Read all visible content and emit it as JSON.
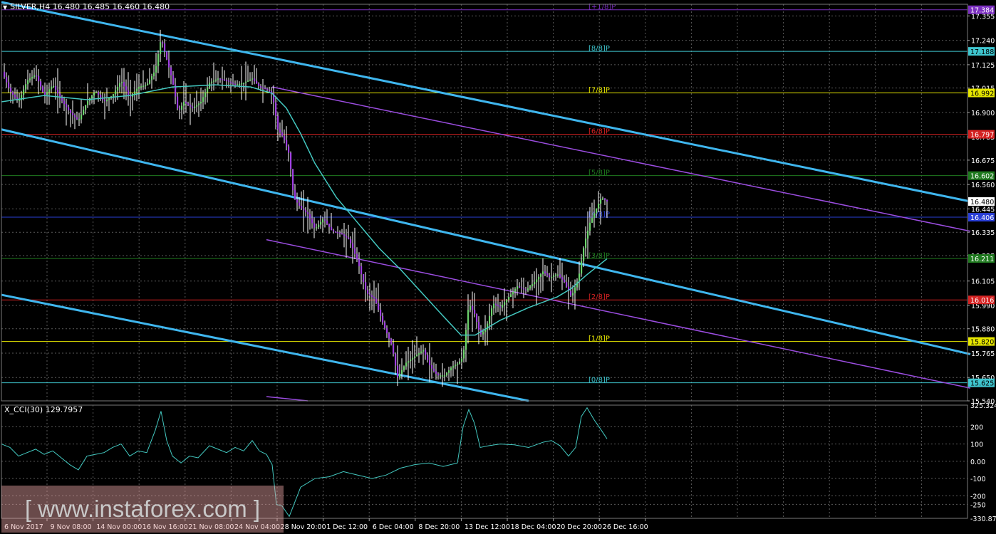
{
  "title": {
    "symbol": "SILVER,H4",
    "prices": "16.480 16.485 16.460 16.480"
  },
  "subtitle": "X_CCI(30) 129.7957",
  "watermark": "[ www.instaforex.com ]",
  "chart_data": [
    {
      "type": "candlestick",
      "ylim": [
        15.54,
        17.41
      ],
      "y_ticks": [
        "17.355",
        "17.240",
        "17.125",
        "17.015",
        "16.900",
        "16.785",
        "16.675",
        "16.560",
        "16.445",
        "16.335",
        "16.225",
        "16.105",
        "15.990",
        "15.880",
        "15.765",
        "15.650",
        "15.540"
      ],
      "x_ticks": [
        "6 Nov 2017",
        "9 Nov 08:00",
        "14 Nov 00:00",
        "16 Nov 16:00",
        "21 Nov 08:00",
        "24 Nov 04:00",
        "28 Nov 20:00",
        "1 Dec 12:00",
        "6 Dec 04:00",
        "8 Dec 20:00",
        "13 Dec 12:00",
        "18 Dec 04:00",
        "20 Dec 20:00",
        "26 Dec 16:00"
      ],
      "current_price": {
        "label": "16.480",
        "value": 16.48
      },
      "close_path": [
        [
          0,
          17.1
        ],
        [
          12,
          17.0
        ],
        [
          24,
          16.95
        ],
        [
          36,
          17.05
        ],
        [
          48,
          17.08
        ],
        [
          60,
          16.98
        ],
        [
          72,
          17.03
        ],
        [
          84,
          16.96
        ],
        [
          96,
          16.9
        ],
        [
          108,
          16.86
        ],
        [
          120,
          16.95
        ],
        [
          132,
          17.0
        ],
        [
          144,
          16.95
        ],
        [
          156,
          16.98
        ],
        [
          168,
          17.05
        ],
        [
          180,
          16.97
        ],
        [
          192,
          17.02
        ],
        [
          204,
          17.03
        ],
        [
          216,
          17.1
        ],
        [
          224,
          17.25
        ],
        [
          232,
          17.15
        ],
        [
          240,
          17.05
        ],
        [
          248,
          16.9
        ],
        [
          256,
          16.95
        ],
        [
          268,
          16.92
        ],
        [
          280,
          16.95
        ],
        [
          292,
          17.04
        ],
        [
          304,
          17.06
        ],
        [
          316,
          17.05
        ],
        [
          328,
          17.03
        ],
        [
          340,
          17.04
        ],
        [
          352,
          17.06
        ],
        [
          362,
          17.02
        ],
        [
          372,
          17.01
        ],
        [
          380,
          16.99
        ],
        [
          388,
          16.82
        ],
        [
          396,
          16.78
        ],
        [
          404,
          16.7
        ],
        [
          410,
          16.5
        ],
        [
          420,
          16.45
        ],
        [
          430,
          16.42
        ],
        [
          440,
          16.35
        ],
        [
          452,
          16.4
        ],
        [
          464,
          16.34
        ],
        [
          476,
          16.33
        ],
        [
          488,
          16.3
        ],
        [
          500,
          16.2
        ],
        [
          512,
          16.05
        ],
        [
          524,
          16.02
        ],
        [
          536,
          15.9
        ],
        [
          548,
          15.8
        ],
        [
          556,
          15.65
        ],
        [
          568,
          15.72
        ],
        [
          580,
          15.75
        ],
        [
          592,
          15.78
        ],
        [
          602,
          15.7
        ],
        [
          612,
          15.66
        ],
        [
          622,
          15.66
        ],
        [
          632,
          15.7
        ],
        [
          642,
          15.72
        ],
        [
          648,
          15.75
        ],
        [
          656,
          16.0
        ],
        [
          664,
          15.95
        ],
        [
          672,
          15.85
        ],
        [
          680,
          15.88
        ],
        [
          690,
          16.0
        ],
        [
          700,
          15.98
        ],
        [
          712,
          16.03
        ],
        [
          724,
          16.08
        ],
        [
          736,
          16.06
        ],
        [
          748,
          16.1
        ],
        [
          760,
          16.15
        ],
        [
          770,
          16.12
        ],
        [
          780,
          16.14
        ],
        [
          790,
          16.1
        ],
        [
          800,
          16.03
        ],
        [
          810,
          16.12
        ],
        [
          818,
          16.28
        ],
        [
          826,
          16.38
        ],
        [
          834,
          16.44
        ],
        [
          842,
          16.5
        ],
        [
          850,
          16.48
        ]
      ],
      "moving_average": [
        [
          0,
          16.95
        ],
        [
          60,
          16.98
        ],
        [
          120,
          16.96
        ],
        [
          180,
          16.98
        ],
        [
          240,
          17.02
        ],
        [
          300,
          17.03
        ],
        [
          350,
          17.02
        ],
        [
          380,
          16.99
        ],
        [
          400,
          16.92
        ],
        [
          420,
          16.8
        ],
        [
          440,
          16.66
        ],
        [
          470,
          16.5
        ],
        [
          500,
          16.38
        ],
        [
          530,
          16.26
        ],
        [
          560,
          16.16
        ],
        [
          590,
          16.05
        ],
        [
          620,
          15.94
        ],
        [
          645,
          15.85
        ],
        [
          665,
          15.85
        ],
        [
          700,
          15.92
        ],
        [
          740,
          15.98
        ],
        [
          780,
          16.03
        ],
        [
          800,
          16.07
        ],
        [
          820,
          16.13
        ],
        [
          850,
          16.21
        ]
      ],
      "murrey_levels": [
        {
          "label": "[+1/8]P",
          "value": 17.384,
          "price_label": "17.384",
          "color": "#7b2fbf"
        },
        {
          "label": "[8/8]P",
          "value": 17.188,
          "price_label": "17.188",
          "color": "#3fc6cf"
        },
        {
          "label": "[7/8]P",
          "value": 16.992,
          "price_label": "16.992",
          "color": "#e6e600"
        },
        {
          "label": "[6/8]P",
          "value": 16.797,
          "price_label": "16.797",
          "color": "#d42222"
        },
        {
          "label": "[5/8]P",
          "value": 16.602,
          "price_label": "16.602",
          "color": "#1f7a1f"
        },
        {
          "label": "[4/8]P",
          "value": 16.406,
          "price_label": "16.406",
          "color": "#2a3fd6"
        },
        {
          "label": "[3/8]P",
          "value": 16.211,
          "price_label": "16.211",
          "color": "#1f7a1f"
        },
        {
          "label": "[2/8]P",
          "value": 16.016,
          "price_label": "16.016",
          "color": "#d42222"
        },
        {
          "label": "[1/8]P",
          "value": 15.82,
          "price_label": "15.820",
          "color": "#e6e600"
        },
        {
          "label": "[0/8]P",
          "value": 15.625,
          "price_label": "15.625",
          "color": "#3fc6cf"
        }
      ],
      "channels": [
        {
          "color": "#3fb6ee",
          "points": [
            [
              0,
              17.42
            ],
            [
              1360,
              16.48
            ]
          ]
        },
        {
          "color": "#3fb6ee",
          "points": [
            [
              0,
              16.82
            ],
            [
              1360,
              15.76
            ]
          ]
        },
        {
          "color": "#3fb6ee",
          "points": [
            [
              0,
              16.04
            ],
            [
              740,
              15.54
            ]
          ]
        },
        {
          "color": "#9b4de0",
          "points": [
            [
              380,
              17.02
            ],
            [
              1360,
              16.34
            ]
          ]
        },
        {
          "color": "#9b4de0",
          "points": [
            [
              372,
              16.3
            ],
            [
              1360,
              15.6
            ]
          ]
        },
        {
          "color": "#9b4de0",
          "points": [
            [
              372,
              15.56
            ],
            [
              430,
              15.54
            ]
          ]
        }
      ]
    },
    {
      "type": "line",
      "title": "X_CCI(30) 129.7957",
      "ylim": [
        -330.875,
        325.3242
      ],
      "y_ticks": [
        "325.3242",
        "200",
        "100",
        "0.00",
        "-100",
        "-200",
        "-250",
        "-330.875"
      ],
      "values": [
        [
          0,
          100
        ],
        [
          12,
          80
        ],
        [
          24,
          30
        ],
        [
          36,
          50
        ],
        [
          48,
          70
        ],
        [
          60,
          40
        ],
        [
          72,
          60
        ],
        [
          84,
          20
        ],
        [
          96,
          -20
        ],
        [
          108,
          -50
        ],
        [
          120,
          30
        ],
        [
          132,
          40
        ],
        [
          144,
          50
        ],
        [
          156,
          80
        ],
        [
          168,
          100
        ],
        [
          180,
          30
        ],
        [
          192,
          60
        ],
        [
          204,
          50
        ],
        [
          216,
          180
        ],
        [
          224,
          290
        ],
        [
          232,
          120
        ],
        [
          240,
          30
        ],
        [
          252,
          -10
        ],
        [
          264,
          30
        ],
        [
          276,
          20
        ],
        [
          292,
          90
        ],
        [
          304,
          70
        ],
        [
          316,
          50
        ],
        [
          328,
          80
        ],
        [
          340,
          60
        ],
        [
          352,
          120
        ],
        [
          362,
          60
        ],
        [
          372,
          40
        ],
        [
          380,
          -20
        ],
        [
          386,
          -250
        ],
        [
          394,
          -260
        ],
        [
          404,
          -320
        ],
        [
          420,
          -150
        ],
        [
          440,
          -100
        ],
        [
          460,
          -90
        ],
        [
          480,
          -60
        ],
        [
          500,
          -80
        ],
        [
          520,
          -100
        ],
        [
          540,
          -80
        ],
        [
          560,
          -40
        ],
        [
          580,
          -20
        ],
        [
          600,
          -10
        ],
        [
          620,
          -30
        ],
        [
          640,
          -10
        ],
        [
          648,
          200
        ],
        [
          656,
          300
        ],
        [
          664,
          220
        ],
        [
          672,
          80
        ],
        [
          684,
          90
        ],
        [
          700,
          100
        ],
        [
          720,
          95
        ],
        [
          740,
          80
        ],
        [
          760,
          110
        ],
        [
          772,
          120
        ],
        [
          784,
          90
        ],
        [
          796,
          30
        ],
        [
          806,
          80
        ],
        [
          814,
          260
        ],
        [
          822,
          310
        ],
        [
          832,
          240
        ],
        [
          842,
          180
        ],
        [
          850,
          130
        ]
      ]
    }
  ]
}
